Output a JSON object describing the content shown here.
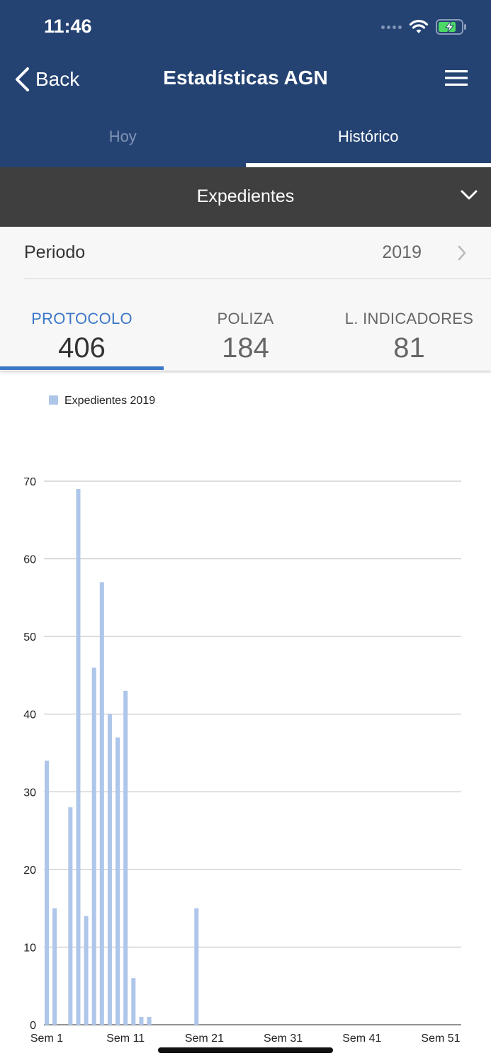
{
  "status_bar": {
    "time": "11:46",
    "icons": [
      "signal-dots-icon",
      "wifi-icon",
      "battery-charging-icon"
    ]
  },
  "nav": {
    "back_label": "Back",
    "title": "Estadísticas AGN",
    "menu_icon": "hamburger-menu-icon"
  },
  "tabs": [
    {
      "label": "Hoy",
      "active": false
    },
    {
      "label": "Histórico",
      "active": true
    }
  ],
  "dropdown": {
    "label": "Expedientes"
  },
  "periodo": {
    "label": "Periodo",
    "value": "2019"
  },
  "stats": [
    {
      "label": "PROTOCOLO",
      "value": "406",
      "active": true
    },
    {
      "label": "POLIZA",
      "value": "184",
      "active": false
    },
    {
      "label": "L. INDICADORES",
      "value": "81",
      "active": false
    }
  ],
  "colors": {
    "header_bg": "#244373",
    "accent": "#3c78c8",
    "bar": "#aec6ea",
    "dropdown_bg": "#3f3f3f"
  },
  "chart_data": {
    "type": "bar",
    "legend": "Expedientes 2019",
    "legend_position": "top-left",
    "weeks": [
      1,
      2,
      3,
      4,
      5,
      6,
      7,
      8,
      9,
      10,
      11,
      12,
      13,
      14,
      15,
      16,
      17,
      18,
      19,
      20,
      21,
      22,
      23,
      24,
      25,
      26,
      27,
      28,
      29,
      30,
      31,
      32,
      33,
      34,
      35,
      36,
      37,
      38,
      39,
      40,
      41,
      42,
      43,
      44,
      45,
      46,
      47,
      48,
      49,
      50,
      51
    ],
    "values": [
      34,
      15,
      0,
      28,
      69,
      14,
      46,
      57,
      40,
      37,
      43,
      6,
      1,
      1,
      0,
      0,
      0,
      0,
      0,
      15,
      0,
      0,
      0,
      0,
      0,
      0,
      0,
      0,
      0,
      0,
      0,
      0,
      0,
      0,
      0,
      0,
      0,
      0,
      0,
      0,
      0,
      0,
      0,
      0,
      0,
      0,
      0,
      0,
      0,
      0,
      0
    ],
    "x_tick_labels": [
      "Sem 1",
      "Sem 11",
      "Sem 21",
      "Sem 31",
      "Sem 41",
      "Sem 51"
    ],
    "y_ticks": [
      0,
      10,
      20,
      30,
      40,
      50,
      60,
      70
    ],
    "ylim": [
      0,
      70
    ],
    "grid": true
  }
}
